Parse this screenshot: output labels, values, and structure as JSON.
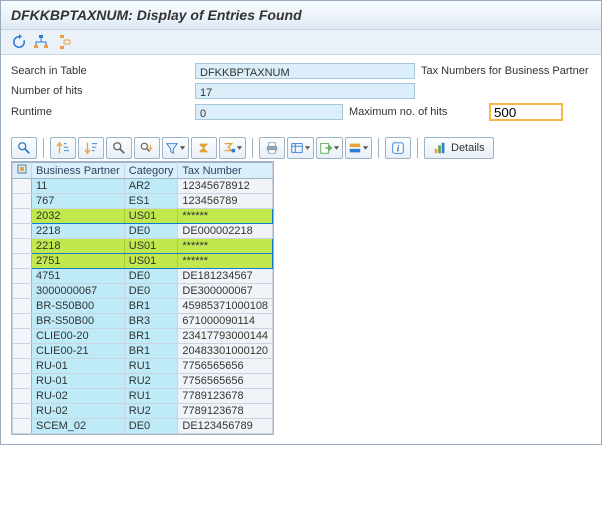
{
  "title": "DFKKBPTAXNUM: Display of Entries Found",
  "form": {
    "search_label": "Search in Table",
    "search_value": "DFKKBPTAXNUM",
    "search_desc": "Tax Numbers for Business Partner",
    "hits_label": "Number of hits",
    "hits_value": "17",
    "runtime_label": "Runtime",
    "runtime_value": "0",
    "max_label": "Maximum no. of hits",
    "max_value": "500"
  },
  "details_label": "Details",
  "columns": {
    "bp": "Business Partner",
    "cat": "Category",
    "tax": "Tax Number"
  },
  "rows": [
    {
      "bp": "11",
      "cat": "AR2",
      "tax": "12345678912",
      "hl": false
    },
    {
      "bp": "767",
      "cat": "ES1",
      "tax": "123456789",
      "hl": false
    },
    {
      "bp": "2032",
      "cat": "US01",
      "tax": "******",
      "hl": true
    },
    {
      "bp": "2218",
      "cat": "DE0",
      "tax": "DE000002218",
      "hl": false
    },
    {
      "bp": "2218",
      "cat": "US01",
      "tax": "******",
      "hl": true
    },
    {
      "bp": "2751",
      "cat": "US01",
      "tax": "******",
      "hl": true
    },
    {
      "bp": "4751",
      "cat": "DE0",
      "tax": "DE181234567",
      "hl": false
    },
    {
      "bp": "3000000067",
      "cat": "DE0",
      "tax": "DE300000067",
      "hl": false
    },
    {
      "bp": "BR-S50B00",
      "cat": "BR1",
      "tax": "45985371000108",
      "hl": false
    },
    {
      "bp": "BR-S50B00",
      "cat": "BR3",
      "tax": "671000090114",
      "hl": false
    },
    {
      "bp": "CLIE00-20",
      "cat": "BR1",
      "tax": "23417793000144",
      "hl": false
    },
    {
      "bp": "CLIE00-21",
      "cat": "BR1",
      "tax": "20483301000120",
      "hl": false
    },
    {
      "bp": "RU-01",
      "cat": "RU1",
      "tax": "7756565656",
      "hl": false
    },
    {
      "bp": "RU-01",
      "cat": "RU2",
      "tax": "7756565656",
      "hl": false
    },
    {
      "bp": "RU-02",
      "cat": "RU1",
      "tax": "7789123678",
      "hl": false
    },
    {
      "bp": "RU-02",
      "cat": "RU2",
      "tax": "7789123678",
      "hl": false
    },
    {
      "bp": "SCEM_02",
      "cat": "DE0",
      "tax": "DE123456789",
      "hl": false
    }
  ]
}
